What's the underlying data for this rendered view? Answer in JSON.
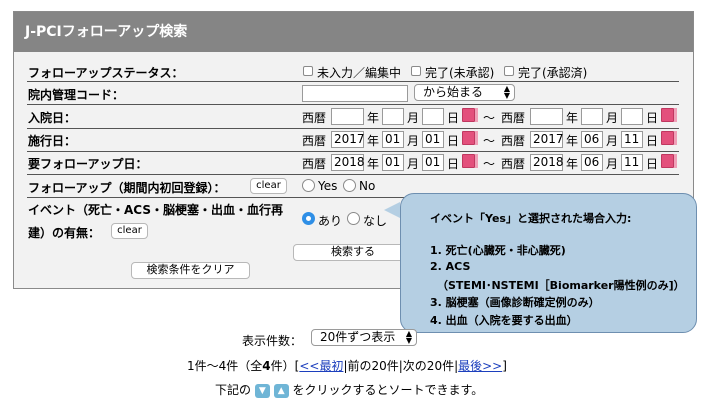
{
  "panel": {
    "title": "J-PCIフォローアップ検索"
  },
  "followup_status": {
    "label": "フォローアップステータス：",
    "options": [
      "未入力／編集中",
      "完了(未承認)",
      "完了(承認済)"
    ]
  },
  "hospital_code": {
    "label": "院内管理コード：",
    "value": "",
    "match_mode": "から始まる"
  },
  "admission_date": {
    "label": "入院日：",
    "era": "西暦",
    "from": {
      "year": "",
      "month": "",
      "day": ""
    },
    "to": {
      "year": "",
      "month": "",
      "day": ""
    }
  },
  "procedure_date": {
    "label": "施行日：",
    "era": "西暦",
    "from": {
      "year": "2017",
      "month": "01",
      "day": "01"
    },
    "to": {
      "year": "2017",
      "month": "06",
      "day": "11"
    }
  },
  "followup_required_date": {
    "label": "要フォローアップ日：",
    "era": "西暦",
    "from": {
      "year": "2018",
      "month": "01",
      "day": "01"
    },
    "to": {
      "year": "2018",
      "month": "06",
      "day": "11"
    }
  },
  "date_units": {
    "year": "年",
    "month": "月",
    "day": "日",
    "tilde": "〜"
  },
  "followup_first": {
    "label": "フォローアップ（期間内初回登録）：",
    "clear_label": "clear",
    "yes_label": "Yes",
    "no_label": "No"
  },
  "events": {
    "label_line1": "イベント（死亡・ACS・脳梗塞・出血・血行再",
    "label_line2": "建）の有無：",
    "clear_label": "clear",
    "yes_label": "あり",
    "no_label": "なし",
    "selected": "あり"
  },
  "search_button_label": "検索する",
  "clear_conditions_label": "検索条件をクリア",
  "callout": {
    "title": "イベント「Yes」と選択された場合入力:",
    "lines": [
      "1. 死亡(心臓死・非心臓死)",
      "2. ACS",
      "（STEMI･NSTEMI［Biomarker陽性例のみ]）",
      "3. 脳梗塞（画像診断確定例のみ）",
      "4. 出血（入院を要する出血）"
    ]
  },
  "results": {
    "display_count_label": "表示件数：",
    "display_count_value": "20件ずつ表示",
    "summary_prefix": "1件〜4件（全",
    "summary_total": "4",
    "summary_suffix": "件）[",
    "first_link": "<<最初",
    "prev_text": "|前の20件|次の20件|",
    "last_link": "最後>>",
    "close_bracket": "]",
    "sort_prefix": "下記の",
    "sort_suffix": "をクリックするとソートできます。"
  },
  "colors": {
    "header_bg": "#858585",
    "panel_bg": "#f2f2f2",
    "callout_bg": "#b5cfe3",
    "calendar_icon": "#e3507c",
    "radio_selected": "#2f8fe6"
  }
}
